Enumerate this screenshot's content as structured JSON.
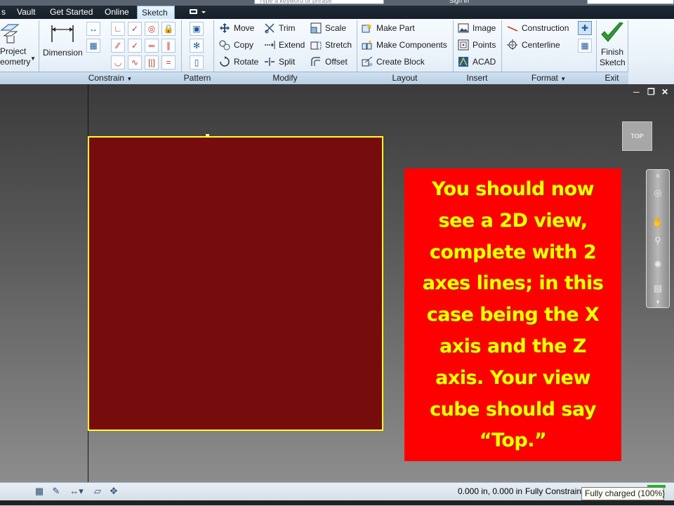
{
  "top_strip": {
    "search_placeholder": "Type a keyword or phrase",
    "sign_in": "Sign In"
  },
  "tabs": [
    {
      "label": "s",
      "active": false
    },
    {
      "label": "Vault",
      "active": false
    },
    {
      "label": "Get Started",
      "active": false
    },
    {
      "label": "Online",
      "active": false
    },
    {
      "label": "Sketch",
      "active": true
    }
  ],
  "ribbon": {
    "draw": {
      "project_geometry_line1": "Project",
      "project_geometry_line2": "eometry"
    },
    "constrain": {
      "title": "Constrain",
      "dimension_label": "Dimension"
    },
    "pattern": {
      "title": "Pattern"
    },
    "modify": {
      "title": "Modify",
      "move": "Move",
      "copy": "Copy",
      "rotate": "Rotate",
      "trim": "Trim",
      "extend": "Extend",
      "split": "Split",
      "scale": "Scale",
      "stretch": "Stretch",
      "offset": "Offset"
    },
    "layout": {
      "title": "Layout",
      "make_part": "Make Part",
      "make_components": "Make Components",
      "create_block": "Create Block"
    },
    "insert": {
      "title": "Insert",
      "image": "Image",
      "points": "Points",
      "acad": "ACAD"
    },
    "format": {
      "title": "Format",
      "construction": "Construction",
      "centerline": "Centerline"
    },
    "exit": {
      "title": "Exit",
      "finish_line1": "Finish",
      "finish_line2": "Sketch"
    }
  },
  "viewport": {
    "viewcube_label": "TOP",
    "callout_text": "You should now see a 2D view, complete with 2 axes lines; in this case being the X axis and the Z axis.  Your view cube should say “Top.”"
  },
  "status": {
    "coordinates": "0.000 in, 0.000 in",
    "constraint_state": "Fully Constrained",
    "tooltip": "Fully charged (100%)"
  },
  "colors": {
    "sketch_fill": "#760c0b",
    "sketch_border": "#ffff22",
    "callout_bg": "#ff0000",
    "callout_text": "#ffff00",
    "finish_check": "#2e9e2e"
  }
}
